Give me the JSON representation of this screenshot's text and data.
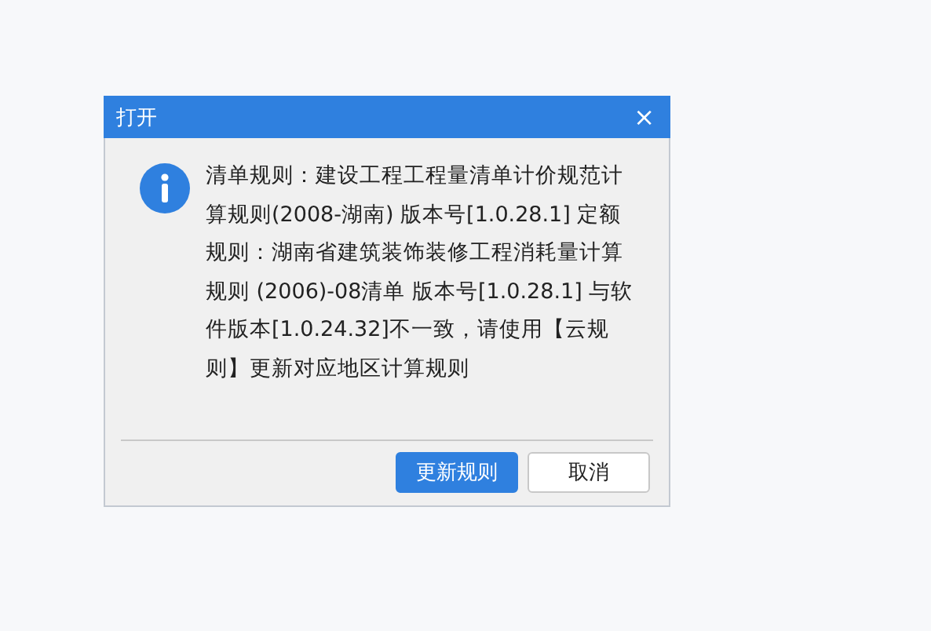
{
  "window": {
    "title": "打开",
    "close": "×"
  },
  "message": "清单规则：建设工程工程量清单计价规范计算规则(2008-湖南) 版本号[1.0.28.1] 定额规则：湖南省建筑装饰装修工程消耗量计算规则 (2006)-08清单 版本号[1.0.28.1] 与软件版本[1.0.24.32]不一致，请使用【云规则】更新对应地区计算规则",
  "buttons": [
    {
      "label": "更新规则",
      "kind": "primary"
    },
    {
      "label": "取消",
      "kind": "secondary"
    }
  ]
}
